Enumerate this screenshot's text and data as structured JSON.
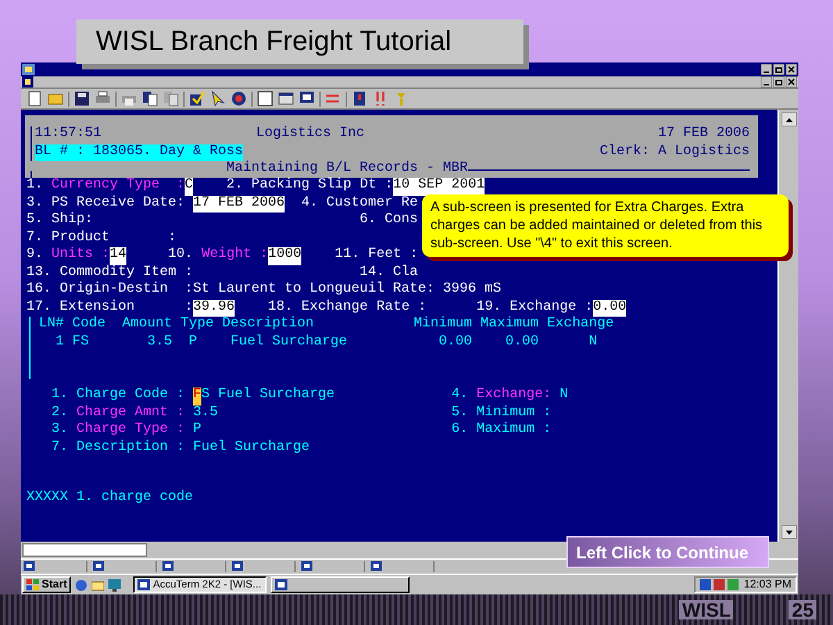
{
  "slide": {
    "title": "WISL Branch Freight Tutorial",
    "footer_label": "WISL",
    "page_number": "25"
  },
  "terminal": {
    "header": {
      "time": "11:57:51",
      "company": "Logistics Inc",
      "date": "17 FEB 2006",
      "record": "BL # : 183065. Day & Ross",
      "clerk": "Clerk: A Logistics",
      "screen_title": "Maintaining B/L Records - MBR"
    },
    "sections": [
      {
        "kind": "form",
        "lines": [
          [
            {
              "kind": "text",
              "text": "1. "
            },
            {
              "kind": "label",
              "text": "Currency Type  :"
            },
            {
              "kind": "value",
              "text": "C"
            },
            {
              "kind": "text",
              "text": "    2. Packing Slip Dt :"
            },
            {
              "kind": "value",
              "text": "10 SEP 2001"
            }
          ],
          [
            {
              "kind": "text",
              "text": "3. PS Receive Date: "
            },
            {
              "kind": "value",
              "text": "17 FEB 2006"
            },
            {
              "kind": "text",
              "text": "  4. Customer Re"
            }
          ],
          [
            {
              "kind": "text",
              "text": "5. Ship:"
            },
            {
              "kind": "text",
              "text": "                                6. Cons"
            }
          ],
          [
            {
              "kind": "text",
              "text": "7. Product       :"
            }
          ],
          [
            {
              "kind": "text",
              "text": "9. "
            },
            {
              "kind": "label",
              "text": "Units :"
            },
            {
              "kind": "value",
              "text": "14"
            },
            {
              "kind": "text",
              "text": "     10. "
            },
            {
              "kind": "label",
              "text": "Weight :"
            },
            {
              "kind": "value",
              "text": "1000"
            },
            {
              "kind": "text",
              "text": "    11. Feet :"
            }
          ],
          [
            {
              "kind": "text",
              "text": "13. Commodity Item :"
            },
            {
              "kind": "text",
              "text": "                    14. Cla"
            }
          ],
          [
            {
              "kind": "text",
              "text": "16. Origin-Destin  :St Laurent to Longueuil Rate: 3996 mS"
            }
          ],
          [
            {
              "kind": "text",
              "text": "17. Extension      :"
            },
            {
              "kind": "value",
              "text": "39.96"
            },
            {
              "kind": "text",
              "text": "    18. Exchange Rate :      19. Exchange :"
            },
            {
              "kind": "value",
              "text": "0.00"
            }
          ]
        ]
      },
      {
        "kind": "list",
        "lines": [
          [
            {
              "kind": "data",
              "text": "LN# Code  Amount Type Description            Minimum Maximum Exchange"
            }
          ],
          [
            {
              "kind": "data",
              "text": "  1 FS       3.5  P    Fuel Surcharge           0.00    0.00      N"
            }
          ]
        ]
      },
      {
        "kind": "detail",
        "lines": [
          [
            {
              "kind": "data",
              "text": "  1. Charge Code : "
            },
            {
              "kind": "cursor",
              "text": "F"
            },
            {
              "kind": "data",
              "text": "S Fuel Surcharge"
            },
            {
              "kind": "data",
              "text": "              4. "
            },
            {
              "kind": "label",
              "text": "Exchange:"
            },
            {
              "kind": "data",
              "text": " N"
            }
          ],
          [
            {
              "kind": "data",
              "text": "  2. "
            },
            {
              "kind": "label",
              "text": "Charge Amnt :"
            },
            {
              "kind": "data",
              "text": " 3.5"
            },
            {
              "kind": "data",
              "text": "                            5. Minimum :"
            }
          ],
          [
            {
              "kind": "data",
              "text": "  3. "
            },
            {
              "kind": "label",
              "text": "Charge Type :"
            },
            {
              "kind": "data",
              "text": " P"
            },
            {
              "kind": "data",
              "text": "                              6. Maximum :"
            }
          ],
          [
            {
              "kind": "data",
              "text": "  7. Description : Fuel Surcharge"
            }
          ]
        ]
      },
      {
        "kind": "prompt",
        "lines": [
          [
            {
              "kind": "data",
              "text": "XXXXX 1. charge code"
            }
          ]
        ]
      }
    ]
  },
  "callout": {
    "text": "A sub-screen is presented for Extra Charges. Extra charges can be added maintained or deleted from this sub-screen. Use \"\\4\" to exit this screen."
  },
  "continue_button": {
    "label": "Left Click to Continue"
  },
  "taskbar": {
    "start": "Start",
    "tasks": [
      {
        "label": "AccuTerm 2K2 - [WIS...",
        "selected": true
      },
      {
        "selected": false
      }
    ],
    "clock": "12:03 PM"
  }
}
